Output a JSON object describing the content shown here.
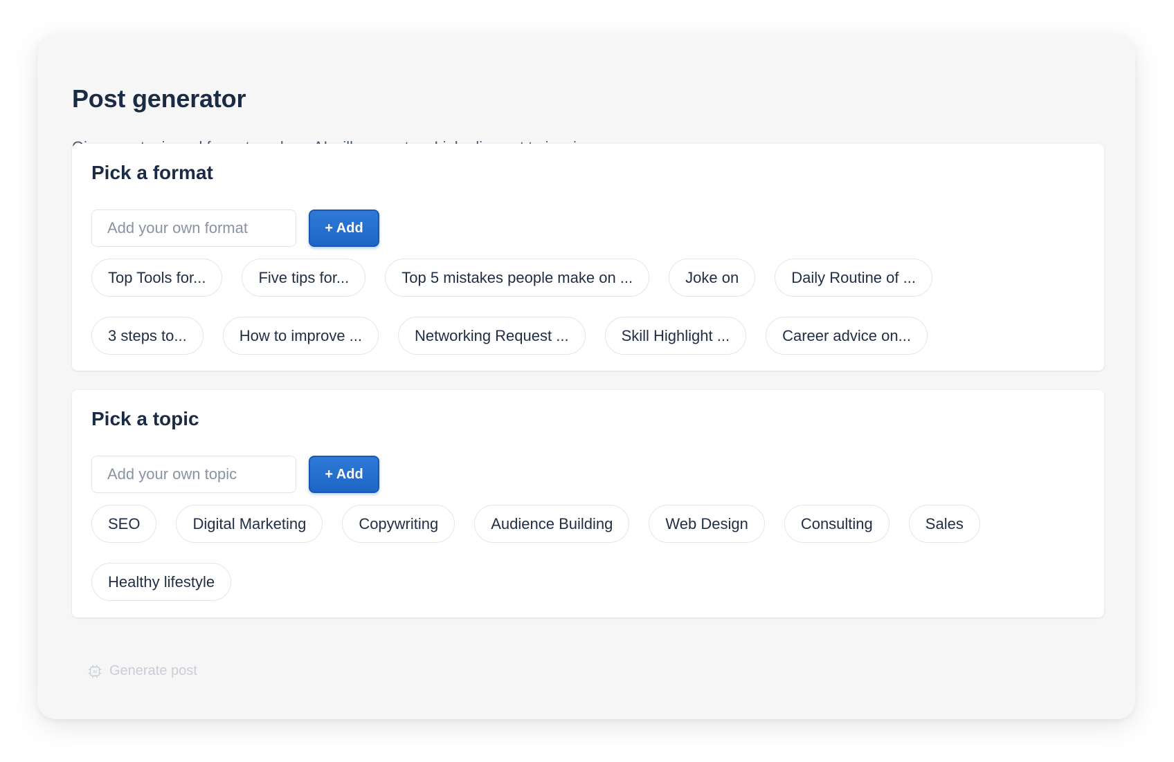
{
  "page": {
    "title": "Post generator",
    "subtitle": "Give us a topic and format, and our AI will generate a Linkedin post to inspire you."
  },
  "format_section": {
    "title": "Pick a format",
    "input_placeholder": "Add your own format",
    "input_value": "",
    "add_label": "+ Add",
    "chips": [
      "Top Tools for...",
      "Five tips for...",
      "Top 5 mistakes people make on ...",
      "Joke on",
      "Daily Routine of ...",
      "3 steps to...",
      "How to improve ...",
      "Networking Request ...",
      "Skill Highlight ...",
      "Career advice on..."
    ]
  },
  "topic_section": {
    "title": "Pick a topic",
    "input_placeholder": "Add your own topic",
    "input_value": "",
    "add_label": "+ Add",
    "chips": [
      "SEO",
      "Digital Marketing",
      "Copywriting",
      "Audience Building",
      "Web Design",
      "Consulting",
      "Sales",
      "Healthy lifestyle"
    ]
  },
  "generate": {
    "label": "Generate post",
    "icon": "ai-chip-icon",
    "enabled": false
  },
  "colors": {
    "accent": "#1d66c6",
    "text": "#1f2d45",
    "muted": "#4a5a72",
    "disabled": "#c9ced6",
    "background": "#f6f6f7"
  }
}
